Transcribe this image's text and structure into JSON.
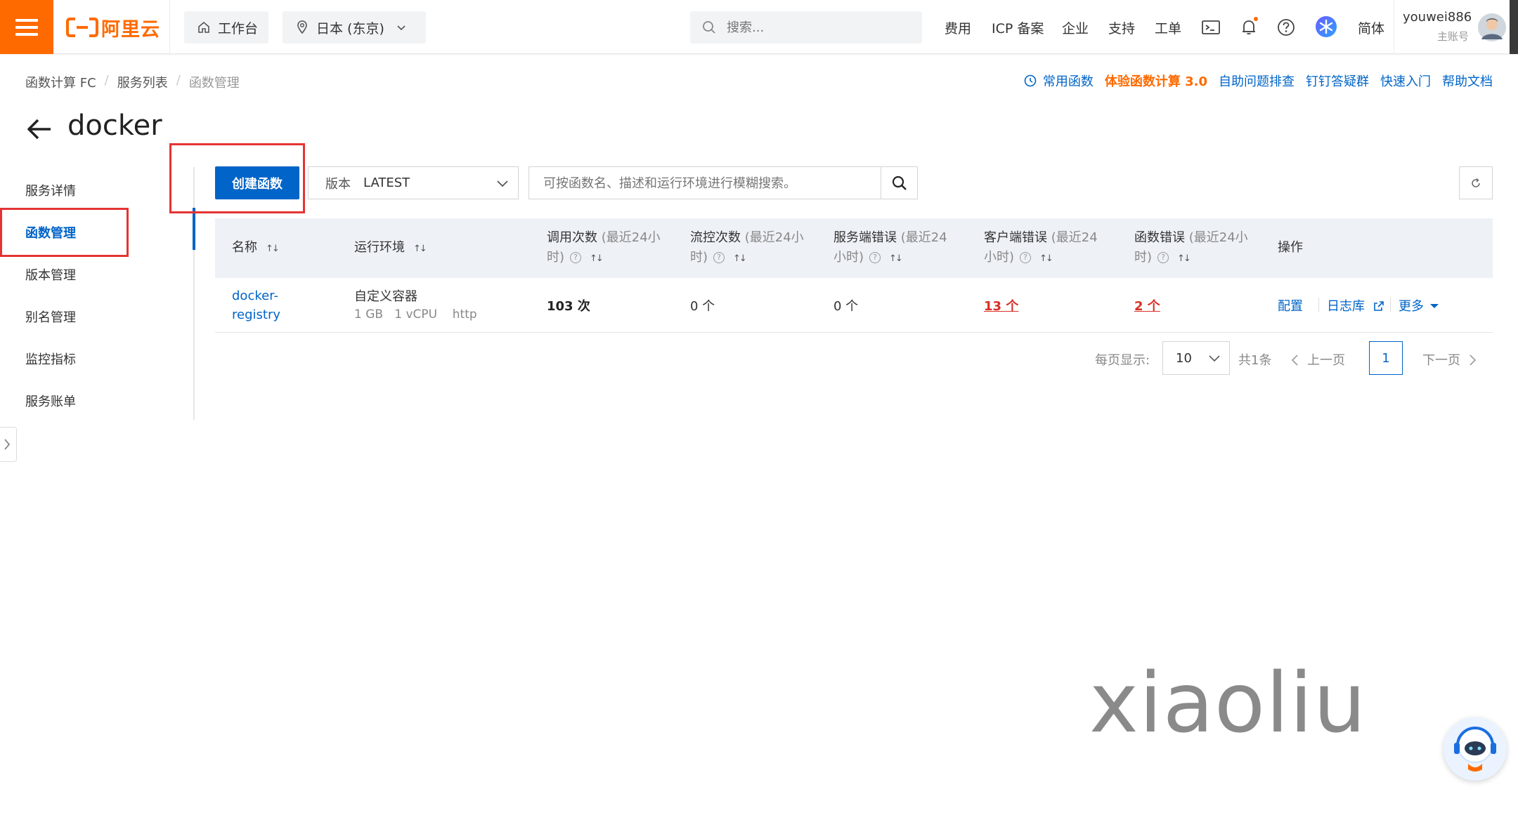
{
  "topbar": {
    "brand": "阿里云",
    "workbench": "工作台",
    "region": "日本 (东京)",
    "search_placeholder": "搜索...",
    "nav": [
      "费用",
      "ICP 备案",
      "企业",
      "支持",
      "工单"
    ],
    "lang": "简体",
    "user": "youwei886",
    "account_type": "主账号"
  },
  "breadcrumb": [
    "函数计算 FC",
    "服务列表",
    "函数管理"
  ],
  "quicklinks": {
    "common_functions": "常用函数",
    "try_fc3": "体验函数计算 3.0",
    "self_diagnose": "自助问题排查",
    "dingtalk": "钉钉答疑群",
    "quickstart": "快速入门",
    "docs": "帮助文档"
  },
  "page_title": "docker",
  "sidenav": [
    "服务详情",
    "函数管理",
    "版本管理",
    "别名管理",
    "监控指标",
    "服务账单"
  ],
  "toolbar": {
    "create_label": "创建函数",
    "version_label": "版本",
    "version_value": "LATEST",
    "search_placeholder": "可按函数名、描述和运行环境进行模糊搜索。"
  },
  "table": {
    "headers": {
      "name": "名称",
      "runtime": "运行环境",
      "invocations": "调用次数",
      "invocations_suffix": "(最近24小",
      "invocations_suffix2": "时)",
      "throttles": "流控次数",
      "throttles_suffix": "(最近24小",
      "throttles_suffix2": "时)",
      "server_errors": "服务端错误",
      "server_errors_suffix": "(最近24",
      "server_errors_suffix2": "小时)",
      "client_errors": "客户端错误",
      "client_errors_suffix": "(最近24",
      "client_errors_suffix2": "小时)",
      "function_errors": "函数错误",
      "function_errors_suffix": "(最近24小",
      "function_errors_suffix2": "时)",
      "actions": "操作"
    },
    "rows": [
      {
        "name_line1": "docker-",
        "name_line2": "registry",
        "runtime": "自定义容器",
        "memory": "1 GB",
        "vcpu": "1 vCPU",
        "trigger": "http",
        "invocations": "103 次",
        "throttles": "0 个",
        "server_errors": "0 个",
        "client_errors": "13 个",
        "function_errors": "2 个",
        "action_config": "配置",
        "action_logs": "日志库",
        "action_more": "更多"
      }
    ]
  },
  "pagination": {
    "per_page_label": "每页显示:",
    "per_page": "10",
    "total": "共1条",
    "prev": "上一页",
    "current": "1",
    "next": "下一页"
  },
  "watermark": "xiaoliu",
  "colors": {
    "brand": "#ff6a00",
    "primary": "#0064c8",
    "error": "#d93026",
    "annotation": "#e53333"
  }
}
